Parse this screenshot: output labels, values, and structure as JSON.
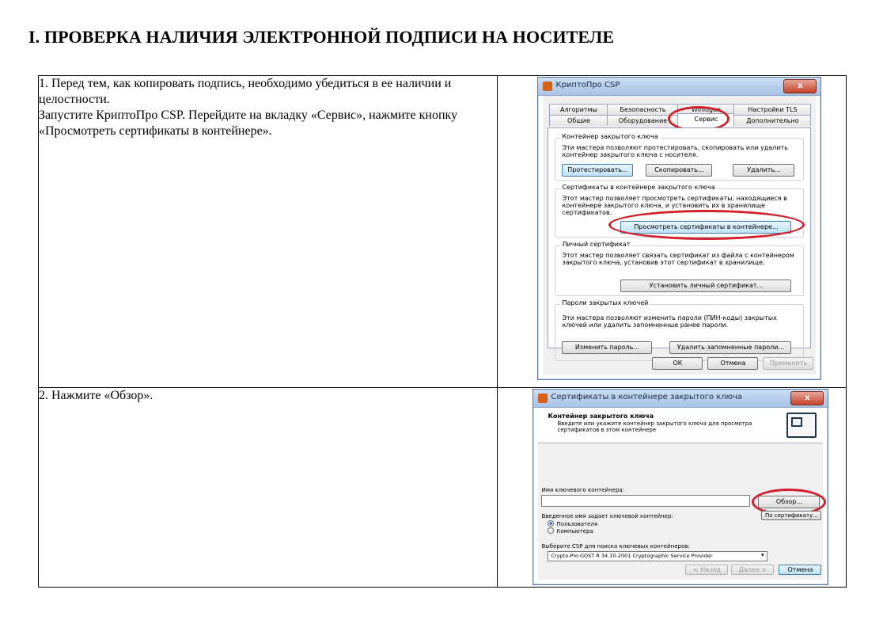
{
  "page": {
    "title": "I. ПРОВЕРКА НАЛИЧИЯ ЭЛЕКТРОННОЙ ПОДПИСИ НА НОСИТЕЛЕ"
  },
  "steps": [
    {
      "paragraphs": [
        "1. Перед тем, как копировать подпись, необходимо убедиться в ее наличии и целостности.",
        "Запустите КриптоПро CSP. Перейдите на вкладку «Сервис», нажмите кнопку «Просмотреть сертификаты в контейнере»."
      ]
    },
    {
      "paragraphs": [
        "2. Нажмите «Обзор»."
      ]
    }
  ],
  "dialog1": {
    "title": "КриптоПро CSP",
    "close_label": "x",
    "tabs_row1": [
      "Алгоритмы",
      "Безопасность",
      "Winlogon",
      "Настройки TLS"
    ],
    "tabs_row2": [
      "Общие",
      "Оборудование",
      "Сервис",
      "Дополнительно"
    ],
    "active_tab": "Сервис",
    "group_container": {
      "legend": "Контейнер закрытого ключа",
      "desc": "Эти мастера позволяют протестировать, скопировать или удалить контейнер закрытого ключа с носителя.",
      "buttons": [
        "Протестировать...",
        "Скопировать...",
        "Удалить..."
      ]
    },
    "group_certs": {
      "legend": "Сертификаты в контейнере закрытого ключа",
      "desc": "Этот мастер позволяет просмотреть сертификаты, находящиеся в контейнере закрытого ключа, и установить их в хранилище сертификатов.",
      "button": "Просмотреть сертификаты в контейнере..."
    },
    "group_personal": {
      "legend": "Личный сертификат",
      "desc": "Этот мастер позволяет связать сертификат из файла с контейнером закрытого ключа, установив этот сертификат в хранилище.",
      "button": "Установить личный сертификат..."
    },
    "group_passwords": {
      "legend": "Пароли закрытых ключей",
      "desc": "Эти мастера позволяют изменить пароли (ПИН-коды) закрытых ключей или удалить запомненные ранее пароли.",
      "buttons": [
        "Изменить пароль...",
        "Удалить запомненные пароли..."
      ]
    },
    "footer": {
      "ok": "ОК",
      "cancel": "Отмена",
      "apply": "Применить"
    }
  },
  "dialog2": {
    "title": "Сертификаты в контейнере закрытого ключа",
    "close_label": "x",
    "header_title": "Контейнер закрытого ключа",
    "header_sub": "Введите или укажите контейнер закрытого ключа для просмотра сертификатов в этом контейнере",
    "name_label": "Имя ключевого контейнера:",
    "name_value": "",
    "browse_button": "Обзор...",
    "by_cert_button": "По сертификату...",
    "radio_label": "Введенное имя задает ключевой контейнер:",
    "radio_options": [
      "Пользователя",
      "Компьютера"
    ],
    "radio_selected": 0,
    "csp_label": "Выберите CSP для поиска ключевых контейнеров:",
    "csp_value": "Crypto-Pro GOST R 34.10-2001 Cryptographic Service Provider",
    "footer": {
      "back": "< Назад",
      "next": "Далее >",
      "cancel": "Отмена"
    }
  },
  "colors": {
    "highlight": "#d1202c",
    "title_bar": "#b7cfeb",
    "dialog_bg": "#f0f0f0"
  }
}
